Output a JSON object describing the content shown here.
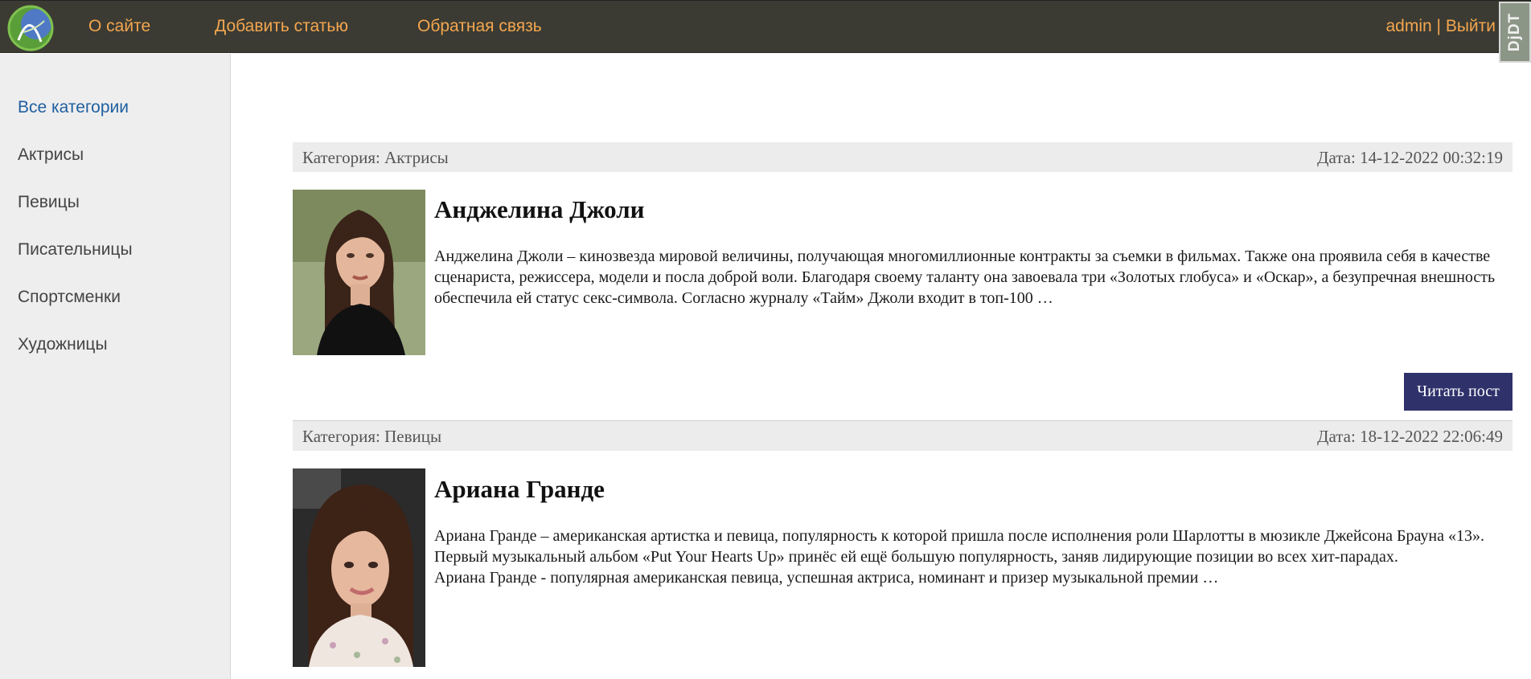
{
  "nav": {
    "about": "О сайте",
    "add_article": "Добавить статью",
    "feedback": "Обратная связь",
    "user": "admin",
    "separator": " | ",
    "logout": "Выйти",
    "debug_toolbar": "DjDT"
  },
  "sidebar": {
    "items": [
      {
        "label": "Все категории"
      },
      {
        "label": "Актрисы"
      },
      {
        "label": "Певицы"
      },
      {
        "label": "Писательницы"
      },
      {
        "label": "Спортсменки"
      },
      {
        "label": "Художницы"
      }
    ]
  },
  "posts": [
    {
      "category": "Категория: Актрисы",
      "date": "Дата: 14-12-2022 00:32:19",
      "title": "Анджелина Джоли",
      "excerpt": "Анджелина Джоли – кинозвезда мировой величины, получающая многомиллионные контракты за съемки в фильмах. Также она проявила себя в качестве сценариста, режиссера, модели и посла доброй воли. Благодаря своему таланту она завоевала три «Золотых глобуса» и «Оскар», а безупречная внешность обеспечила ей статус секс-символа. Согласно журналу «Тайм» Джоли входит в топ-100 …",
      "read_more": "Читать пост"
    },
    {
      "category": "Категория: Певицы",
      "date": "Дата: 18-12-2022 22:06:49",
      "title": "Ариана Гранде",
      "excerpt_line1": "Ариана Гранде – американская артистка и певица, популярность к которой пришла после исполнения роли Шарлотты в мюзикле Джейсона Брауна «13». Первый музыкальный альбом «Put Your Hearts Up» принёс ей ещё большую популярность, заняв лидирующие позиции во всех хит-парадах.",
      "excerpt_line2": "Ариана Гранде - популярная американская певица, успешная актриса, номинант и призер музыкальной премии …"
    }
  ],
  "colors": {
    "topbar": "#3b3b33",
    "nav_link": "#f4a64f",
    "active_category": "#1f5fa0",
    "button": "#2e316a"
  }
}
